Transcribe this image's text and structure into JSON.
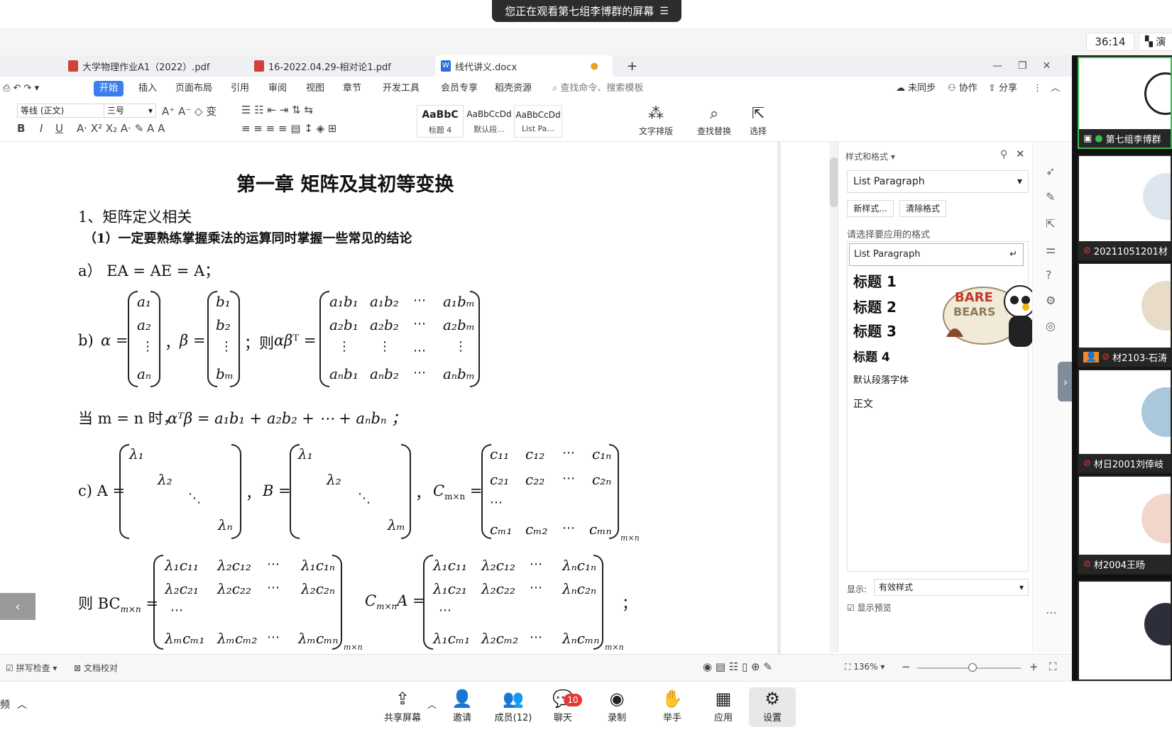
{
  "banner": {
    "sharing_text": "您正在观看第七组李博群的屏幕",
    "menu_icon": "list-icon"
  },
  "meeting": {
    "timer": "36:14",
    "present_label": "演"
  },
  "tabs": [
    {
      "label": "大学物理作业A1（2022）.pdf",
      "type": "pdf"
    },
    {
      "label": "16-2022.04.29-相对论1.pdf",
      "type": "pdf"
    },
    {
      "label": "线代讲义.docx",
      "type": "word"
    }
  ],
  "tabs_add": "+",
  "menu": {
    "items": [
      "开始",
      "插入",
      "页面布局",
      "引用",
      "审阅",
      "视图",
      "章节",
      "开发工具",
      "会员专享",
      "稻壳资源"
    ],
    "search_placeholder": "查找命令、搜索模板",
    "sync": "未同步",
    "collab": "协作",
    "share": "分享"
  },
  "ribbon": {
    "font_name": "等线 (正文)",
    "font_size": "三号",
    "styles": [
      {
        "preview": "AaBbC",
        "label": "标题 4"
      },
      {
        "preview": "AaBbCcDd",
        "label": "默认段..."
      },
      {
        "preview": "AaBbCcDd",
        "label": "List Pa..."
      }
    ],
    "text_layout": "文字排版",
    "find_replace": "查找替换",
    "select": "选择"
  },
  "document": {
    "chapter_title": "第一章  矩阵及其初等变换",
    "section_title": "1、矩阵定义相关",
    "subsection": "（1）一定要熟练掌握乘法的运算同时掌握一些常见的结论",
    "eq_a": "a）  EA = AE = A；",
    "eq_b_label": "b)",
    "eq_b_then": "；则",
    "eq_when": "当 m = n 时，",
    "eq_when_rhs": "αᵀβ = a₁b₁ + a₂b₂ + ⋯ + aₙbₙ ；",
    "eq_c_label": "c) A =",
    "eq_then": "则 BC",
    "semicolon": "；"
  },
  "style_panel": {
    "title": "样式和格式",
    "current": "List Paragraph",
    "new_style": "新样式...",
    "clear_format": "清除格式",
    "choose_label": "请选择要应用的格式",
    "items": [
      "List Paragraph",
      "标题  1",
      "标题  2",
      "标题  3",
      "标题  4",
      "默认段落字体",
      "正文"
    ],
    "show_label": "显示:",
    "show_value": "有效样式",
    "preview_label": "显示预览"
  },
  "statusbar": {
    "spell_check": "拼写检查",
    "doc_proof": "文档校对",
    "zoom": "136%"
  },
  "participants": [
    {
      "name": "第七组李博群"
    },
    {
      "name": "20211051201材"
    },
    {
      "name": "材2103-石涛"
    },
    {
      "name": "材日2001刘倖岐"
    },
    {
      "name": "材2004王旸"
    }
  ],
  "toolbar": {
    "share_screen": "共享屏幕",
    "invite": "邀请",
    "members": "成员(12)",
    "chat": "聊天",
    "chat_badge": "10",
    "record": "录制",
    "raise_hand": "举手",
    "apps": "应用",
    "settings": "设置",
    "left_label": "频"
  },
  "sticker_text": "We BARE BEARS",
  "colors": {
    "accent": "#3c7ef0",
    "badge": "#e53935",
    "banner": "#2d2d2d"
  }
}
